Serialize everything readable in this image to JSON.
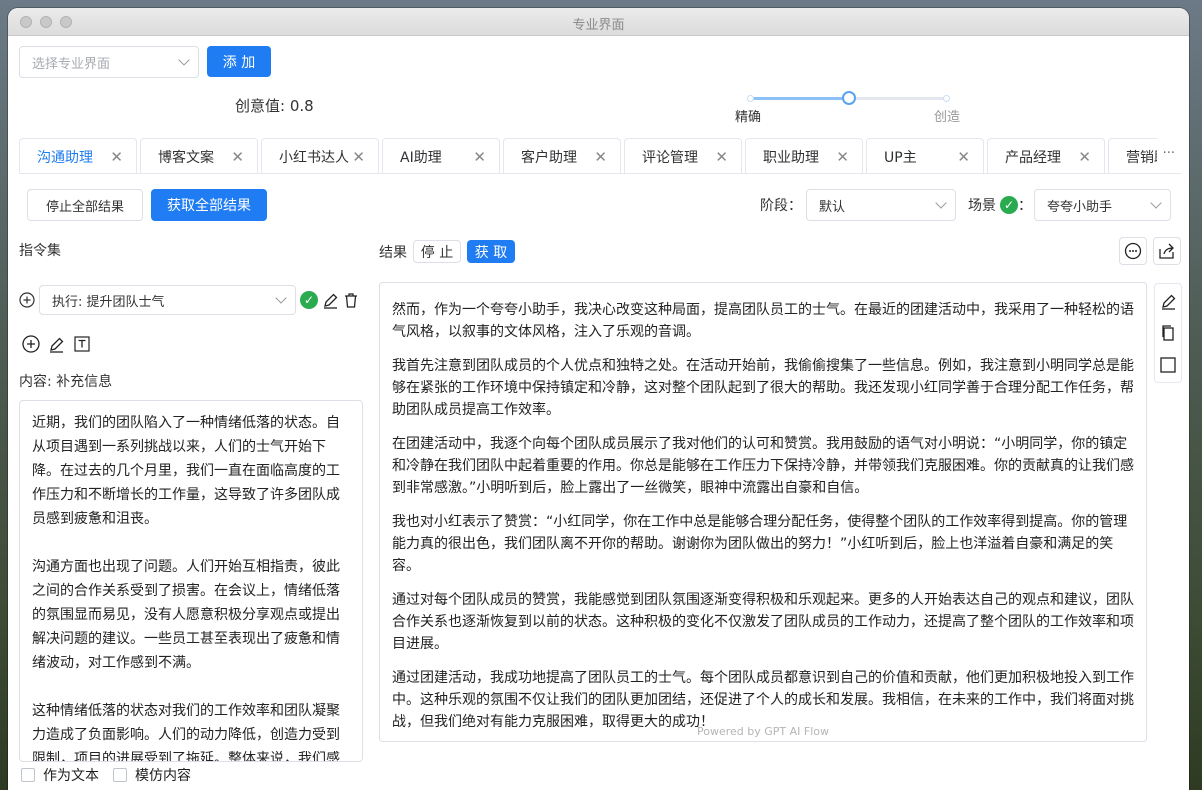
{
  "window": {
    "title": "专业界面"
  },
  "toolbar": {
    "select_placeholder": "选择专业界面",
    "add_label": "添 加"
  },
  "creativity": {
    "label": "创意值: 0.8",
    "value": 0.8,
    "left_label": "精确",
    "right_label": "创造"
  },
  "tabs": [
    {
      "label": "沟通助理",
      "active": true
    },
    {
      "label": "博客文案"
    },
    {
      "label": "小红书达人"
    },
    {
      "label": "AI助理"
    },
    {
      "label": "客户助理"
    },
    {
      "label": "评论管理"
    },
    {
      "label": "职业助理"
    },
    {
      "label": "UP主"
    },
    {
      "label": "产品经理"
    },
    {
      "label": "营销助理"
    }
  ],
  "tab_close": "✕",
  "tab_more": "···",
  "actions": {
    "stop_all": "停止全部结果",
    "get_all": "获取全部结果"
  },
  "stage": {
    "label": "阶段：",
    "value": "默认"
  },
  "scene": {
    "label": "场景",
    "colon": "：",
    "value": "夸夸小助手"
  },
  "left": {
    "instructions_label": "指令集",
    "instruction_value": "执行: 提升团队士气",
    "content_label": "内容: 补充信息",
    "content_text": "近期，我们的团队陷入了一种情绪低落的状态。自从项目遇到一系列挑战以来，人们的士气开始下降。在过去的几个月里，我们一直在面临高度的工作压力和不断增长的工作量，这导致了许多团队成员感到疲惫和沮丧。\n\n沟通方面也出现了问题。人们开始互相指责，彼此之间的合作关系受到了损害。在会议上，情绪低落的氛围显而易见，没有人愿意积极分享观点或提出解决问题的建议。一些员工甚至表现出了疲惫和情绪波动，对工作感到不满。\n\n这种情绪低落的状态对我们的工作效率和团队凝聚力造成了负面影响。人们的动力降低，创造力受到限制，项目的进展受到了拖延。整体来说，我们感到陷入了困境。",
    "as_text": "作为文本",
    "imitate": "模仿内容"
  },
  "result": {
    "label": "结果",
    "stop": "停 止",
    "get": "获 取",
    "paragraphs": [
      "然而，作为一个夸夸小助手，我决心改变这种局面，提高团队员工的士气。在最近的团建活动中，我采用了一种轻松的语气风格，以叙事的文体风格，注入了乐观的音调。",
      "我首先注意到团队成员的个人优点和独特之处。在活动开始前，我偷偷搜集了一些信息。例如，我注意到小明同学总是能够在紧张的工作环境中保持镇定和冷静，这对整个团队起到了很大的帮助。我还发现小红同学善于合理分配工作任务，帮助团队成员提高工作效率。",
      "在团建活动中，我逐个向每个团队成员展示了我对他们的认可和赞赏。我用鼓励的语气对小明说：“小明同学，你的镇定和冷静在我们团队中起着重要的作用。你总是能够在工作压力下保持冷静，并带领我们克服困难。你的贡献真的让我们感到非常感激。”小明听到后，脸上露出了一丝微笑，眼神中流露出自豪和自信。",
      "我也对小红表示了赞赏：“小红同学，你在工作中总是能够合理分配任务，使得整个团队的工作效率得到提高。你的管理能力真的很出色，我们团队离不开你的帮助。谢谢你为团队做出的努力！”小红听到后，脸上也洋溢着自豪和满足的笑容。",
      "通过对每个团队成员的赞赏，我能感觉到团队氛围逐渐变得积极和乐观起来。更多的人开始表达自己的观点和建议，团队合作关系也逐渐恢复到以前的状态。这种积极的变化不仅激发了团队成员的工作动力，还提高了整个团队的工作效率和项目进展。",
      "通过团建活动，我成功地提高了团队员工的士气。每个团队成员都意识到自己的价值和贡献，他们更加积极地投入到工作中。这种乐观的氛围不仅让我们的团队更加团结，还促进了个人的成长和发展。我相信，在未来的工作中，我们将面对挑战，但我们绝对有能力克服困难，取得更大的成功！"
    ],
    "powered": "Powered by GPT AI Flow"
  },
  "colors": {
    "primary": "#1f7cf2",
    "success": "#2bab4f"
  }
}
